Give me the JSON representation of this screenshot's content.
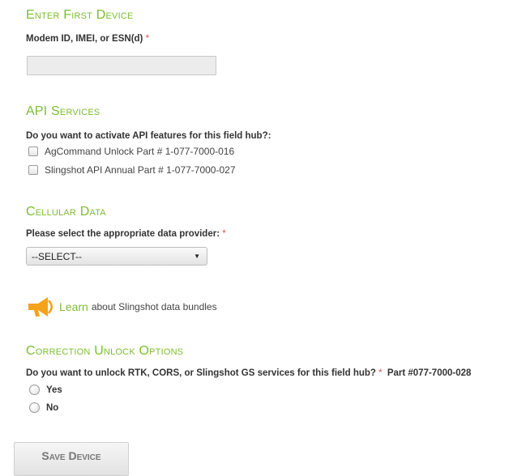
{
  "sections": {
    "first_device": {
      "heading": "Enter First Device",
      "field_label": "Modem ID, IMEI, or ESN(d)",
      "required_mark": "*",
      "field_value": ""
    },
    "api_services": {
      "heading": "API Services",
      "question": "Do you want to activate API features for this field hub?:",
      "options": [
        {
          "label": "AgCommand Unlock Part # 1-077-7000-016",
          "checked": false
        },
        {
          "label": "Slingshot API Annual Part # 1-077-7000-027",
          "checked": false
        }
      ]
    },
    "cellular_data": {
      "heading": "Cellular Data",
      "label": "Please select the appropriate data provider:",
      "required_mark": "*",
      "selected": "--SELECT--"
    },
    "learn": {
      "icon": "megaphone-icon",
      "link_text": "Learn",
      "text": "about Slingshot data bundles"
    },
    "correction_unlock": {
      "heading": "Correction Unlock Options",
      "question": "Do you want to unlock RTK, CORS, or Slingshot GS services for this field hub?",
      "required_mark": "*",
      "part": "Part #077-7000-028",
      "options": [
        {
          "label": "Yes",
          "selected": false
        },
        {
          "label": "No",
          "selected": false
        }
      ]
    }
  },
  "save_button": {
    "label": "Save Device"
  },
  "colors": {
    "accent": "#7cbe31",
    "required": "#d9534f",
    "icon": "#f5a31a"
  }
}
